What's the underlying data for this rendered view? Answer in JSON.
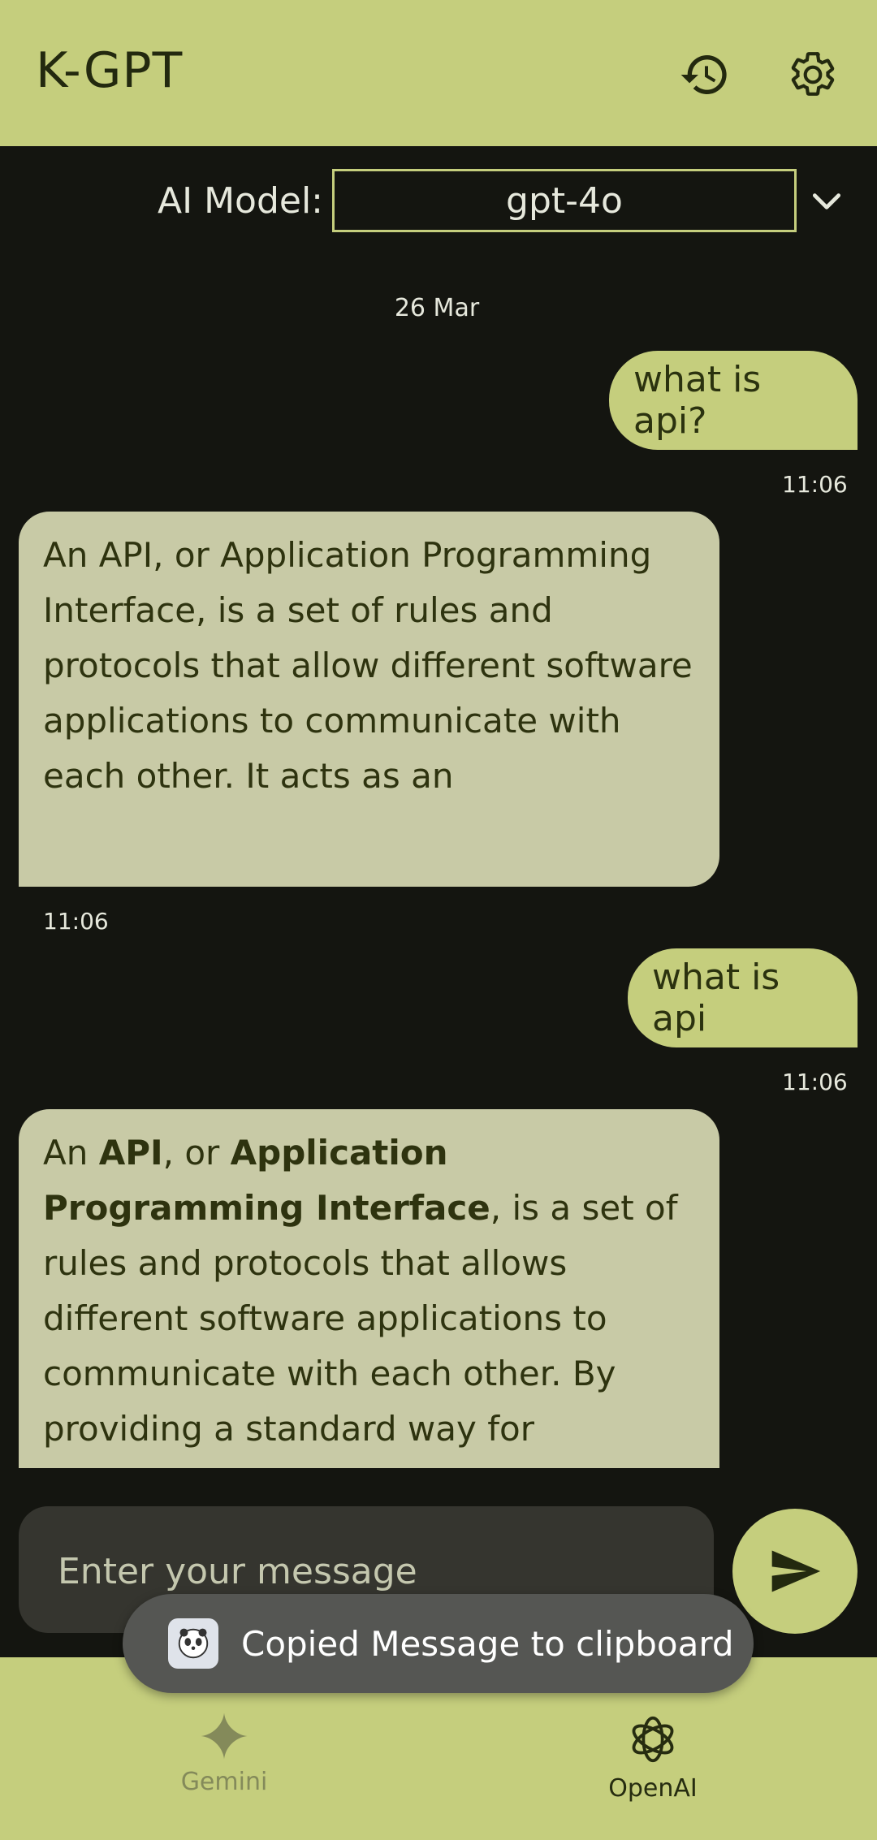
{
  "app": {
    "title": "K-GPT"
  },
  "model": {
    "label": "AI Model:",
    "selected": "gpt-4o"
  },
  "chat": {
    "date": "26 Mar",
    "messages": [
      {
        "role": "user",
        "text": "what is api?",
        "time": "11:06"
      },
      {
        "role": "assistant",
        "text": "An API, or Application Programming Interface, is a set of rules and protocols that allow different software applications to communicate with each other. It acts as an",
        "time": "11:06"
      },
      {
        "role": "user",
        "text": "what is api",
        "time": "11:06"
      },
      {
        "role": "assistant",
        "parts": [
          "An ",
          "API",
          ", or ",
          "Application Programming Interface",
          ", is a set of rules and protocols that allows different software applications to communicate with each other. By providing a standard way for"
        ]
      }
    ]
  },
  "composer": {
    "placeholder": "Enter your message"
  },
  "nav": {
    "gemini": "Gemini",
    "openai": "OpenAI"
  },
  "toast": {
    "text": "Copied Message to clipboard"
  },
  "colors": {
    "accent": "#c5ce7d",
    "background": "#141510",
    "bot_bubble": "#c8caa6",
    "composer": "#35352f"
  },
  "icons": [
    "history-icon",
    "settings-icon",
    "chevron-down-icon",
    "send-icon",
    "gemini-icon",
    "openai-icon",
    "app-icon"
  ]
}
